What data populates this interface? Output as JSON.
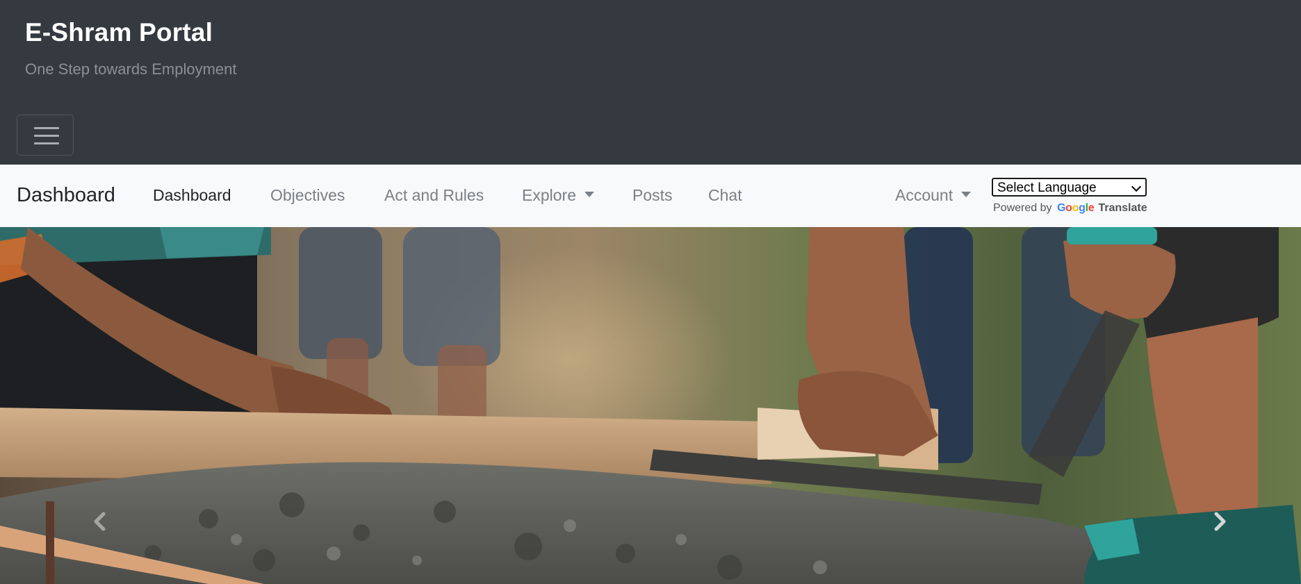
{
  "header": {
    "title": "E-Shram Portal",
    "tagline": "One Step towards Employment",
    "menu_toggle_icon": "hamburger-icon"
  },
  "navbar": {
    "brand": "Dashboard",
    "links": [
      {
        "label": "Dashboard",
        "active": true
      },
      {
        "label": "Objectives"
      },
      {
        "label": "Act and Rules"
      },
      {
        "label": "Explore",
        "dropdown": true
      },
      {
        "label": "Posts"
      },
      {
        "label": "Chat"
      }
    ],
    "account": {
      "label": "Account",
      "dropdown": true
    }
  },
  "translate": {
    "select_value": "Select Language",
    "powered_by": "Powered by",
    "google": "Google",
    "translate_label": "Translate"
  },
  "carousel": {
    "image": "construction workers smoothing wet concrete with a wooden float",
    "prev_icon": "chevron-left-icon",
    "next_icon": "chevron-right-icon"
  },
  "colors": {
    "header_bg": "#343a40",
    "navbar_bg": "#f8f9fa",
    "link_muted": "#7a8086",
    "link_active": "#212529"
  }
}
